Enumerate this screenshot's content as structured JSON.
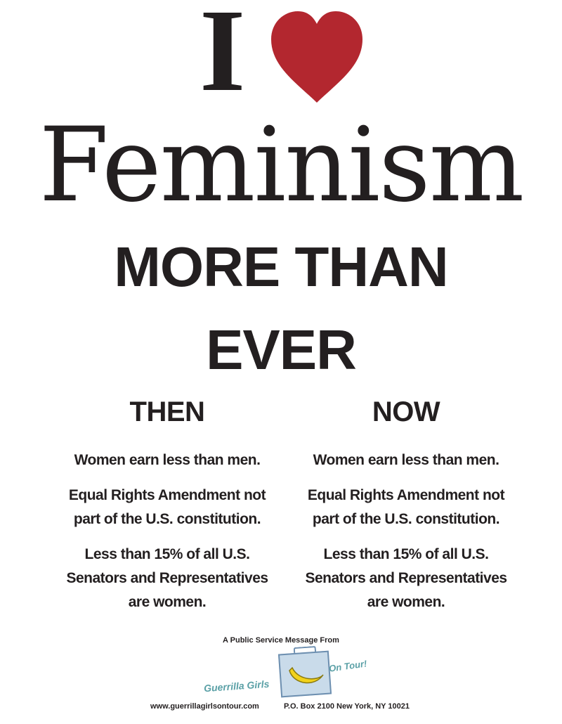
{
  "headline": {
    "i": "I",
    "heart_icon": "heart-icon",
    "heart_color": "#b3272f",
    "word": "Feminism"
  },
  "slogan": {
    "line1": "MORE THAN",
    "line2": "EVER"
  },
  "then": {
    "heading": "THEN",
    "items": [
      "Women earn less than men.",
      "Equal Rights Amendment not part of the U.S. constitution.",
      "Less than 15% of all U.S. Senators and Representatives are women."
    ]
  },
  "now": {
    "heading": "NOW",
    "items": [
      "Women earn less than men.",
      "Equal Rights Amendment not part of the U.S. constitution.",
      "Less than 15% of all U.S. Senators and Representatives are women."
    ]
  },
  "footer": {
    "psa": "A Public Service Message From",
    "logo_left": "Guerrilla Girls",
    "logo_right": "On Tour!",
    "logo_icon": "suitcase-banana-icon",
    "website": "www.guerrillagirlsontour.com",
    "address": "P.O. Box 2100 New York, NY 10021"
  }
}
